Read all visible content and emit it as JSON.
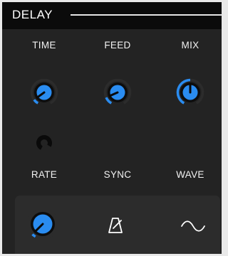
{
  "header": {
    "title": "DELAY"
  },
  "labels": {
    "time": "TIME",
    "feed": "FEED",
    "mix": "MIX",
    "rate": "RATE",
    "sync": "SYNC",
    "wave": "WAVE"
  },
  "knobs": {
    "time": {
      "value": 0.08
    },
    "feed": {
      "value": 0.12
    },
    "mix": {
      "value": 0.5
    },
    "rate": {
      "value": 0.05
    }
  },
  "icons": {
    "link": "link-ring-icon",
    "sync": "metronome-icon",
    "wave": "sine-wave-icon"
  },
  "colors": {
    "accent": "#2a8cf0",
    "panel": "#232323",
    "titlebar": "#0b0b0b",
    "knob_ring": "#0d0d0d"
  }
}
